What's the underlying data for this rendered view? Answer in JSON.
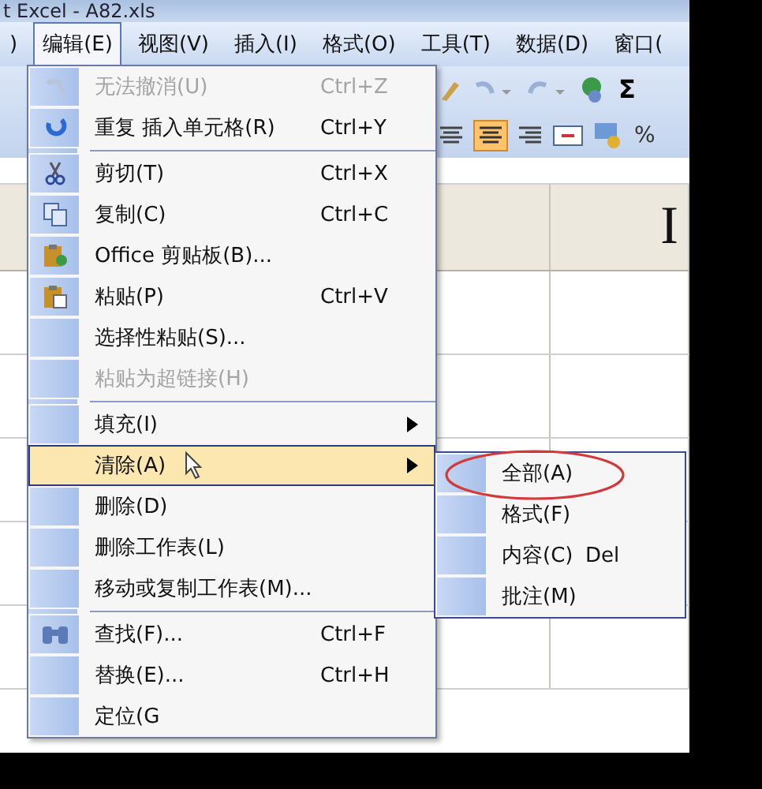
{
  "window": {
    "title": "t Excel - A82.xls"
  },
  "menu_bar": [
    {
      "label": ")",
      "selected": false
    },
    {
      "label": "编辑(E)",
      "selected": true
    },
    {
      "label": "视图(V)",
      "selected": false
    },
    {
      "label": "插入(I)",
      "selected": false
    },
    {
      "label": "格式(O)",
      "selected": false
    },
    {
      "label": "工具(T)",
      "selected": false
    },
    {
      "label": "数据(D)",
      "selected": false
    },
    {
      "label": "窗口(",
      "selected": false
    }
  ],
  "toolbar": {
    "sum": "Σ",
    "percent": "%"
  },
  "sheet": {
    "header_text": "I"
  },
  "edit_menu": [
    {
      "kind": "item",
      "label": "无法撤消(U)",
      "shortcut": "Ctrl+Z",
      "disabled": true,
      "selected": false,
      "submenu": false
    },
    {
      "kind": "item",
      "label": "重复 插入单元格(R)",
      "shortcut": "Ctrl+Y",
      "disabled": false,
      "selected": false,
      "submenu": false
    },
    {
      "kind": "separator"
    },
    {
      "kind": "item",
      "label": "剪切(T)",
      "shortcut": "Ctrl+X",
      "disabled": false,
      "selected": false,
      "submenu": false
    },
    {
      "kind": "item",
      "label": "复制(C)",
      "shortcut": "Ctrl+C",
      "disabled": false,
      "selected": false,
      "submenu": false
    },
    {
      "kind": "item",
      "label": "Office 剪贴板(B)...",
      "disabled": false,
      "selected": false,
      "submenu": false
    },
    {
      "kind": "item",
      "label": "粘贴(P)",
      "shortcut": "Ctrl+V",
      "disabled": false,
      "selected": false,
      "submenu": false
    },
    {
      "kind": "item",
      "label": "选择性粘贴(S)...",
      "disabled": false,
      "selected": false,
      "submenu": false
    },
    {
      "kind": "item",
      "label": "粘贴为超链接(H)",
      "disabled": true,
      "selected": false,
      "submenu": false
    },
    {
      "kind": "separator"
    },
    {
      "kind": "item",
      "label": "填充(I)",
      "disabled": false,
      "selected": false,
      "submenu": true
    },
    {
      "kind": "item",
      "label": "清除(A)",
      "disabled": false,
      "selected": true,
      "submenu": true
    },
    {
      "kind": "item",
      "label": "删除(D)",
      "disabled": false,
      "selected": false,
      "submenu": false
    },
    {
      "kind": "item",
      "label": "删除工作表(L)",
      "disabled": false,
      "selected": false,
      "submenu": false
    },
    {
      "kind": "item",
      "label": "移动或复制工作表(M)...",
      "disabled": false,
      "selected": false,
      "submenu": false
    },
    {
      "kind": "separator"
    },
    {
      "kind": "item",
      "label": "查找(F)...",
      "shortcut": "Ctrl+F",
      "disabled": false,
      "selected": false,
      "submenu": false
    },
    {
      "kind": "item",
      "label": "替换(E)...",
      "shortcut": "Ctrl+H",
      "disabled": false,
      "selected": false,
      "submenu": false
    },
    {
      "kind": "item",
      "label": "定位(G",
      "disabled": false,
      "selected": false,
      "submenu": false
    }
  ],
  "clear_submenu": [
    {
      "label": "全部(A)",
      "circled": true
    },
    {
      "label": "格式(F)",
      "circled": false
    },
    {
      "label": "内容(C)",
      "shortcut": "Del",
      "circled": false
    },
    {
      "label": "批注(M)",
      "circled": false
    }
  ]
}
